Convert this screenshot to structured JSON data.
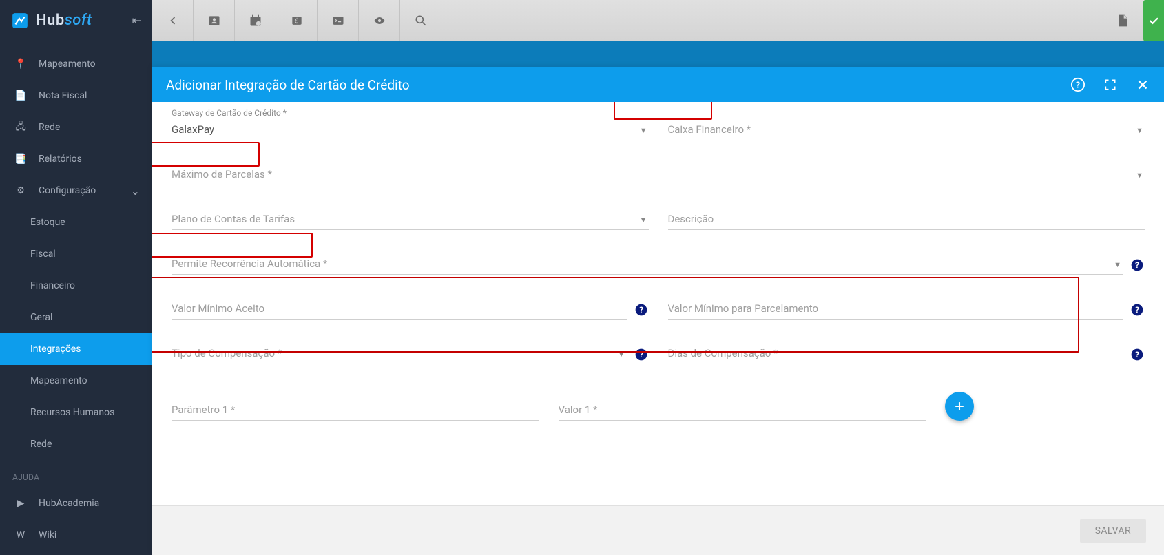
{
  "brand": {
    "hub": "Hub",
    "soft": "soft"
  },
  "sidebar": {
    "items": [
      {
        "label": "Mapeamento",
        "icon": "pin-icon"
      },
      {
        "label": "Nota Fiscal",
        "icon": "receipt-icon"
      },
      {
        "label": "Rede",
        "icon": "network-icon"
      },
      {
        "label": "Relatórios",
        "icon": "report-icon"
      },
      {
        "label": "Configuração",
        "icon": "gear-icon",
        "expandable": true
      }
    ],
    "subitems": [
      {
        "label": "Estoque"
      },
      {
        "label": "Fiscal"
      },
      {
        "label": "Financeiro"
      },
      {
        "label": "Geral"
      },
      {
        "label": "Integrações",
        "active": true
      },
      {
        "label": "Mapeamento"
      },
      {
        "label": "Recursos Humanos"
      },
      {
        "label": "Rede"
      }
    ],
    "help_header": "AJUDA",
    "help_items": [
      {
        "label": "HubAcademia",
        "icon": "youtube-icon"
      },
      {
        "label": "Wiki",
        "icon": "wiki-icon"
      }
    ]
  },
  "modal": {
    "title": "Adicionar Integração de Cartão de Crédito",
    "fields": {
      "gateway_label": "Gateway de Cartão de Crédito *",
      "gateway_value": "GalaxPay",
      "caixa_placeholder": "Caixa Financeiro *",
      "max_parcelas_placeholder": "Máximo de Parcelas *",
      "plano_contas_placeholder": "Plano de Contas de Tarifas",
      "descricao_placeholder": "Descrição",
      "recorrencia_placeholder": "Permite Recorrência Automática *",
      "valor_minimo_placeholder": "Valor Mínimo Aceito",
      "valor_minimo_parc_placeholder": "Valor Mínimo para Parcelamento",
      "tipo_comp_placeholder": "Tipo de Compensação *",
      "dias_comp_placeholder": "Dias de Compensação *",
      "param1_placeholder": "Parâmetro 1 *",
      "valor1_placeholder": "Valor 1 *"
    },
    "save_label": "SALVAR"
  }
}
